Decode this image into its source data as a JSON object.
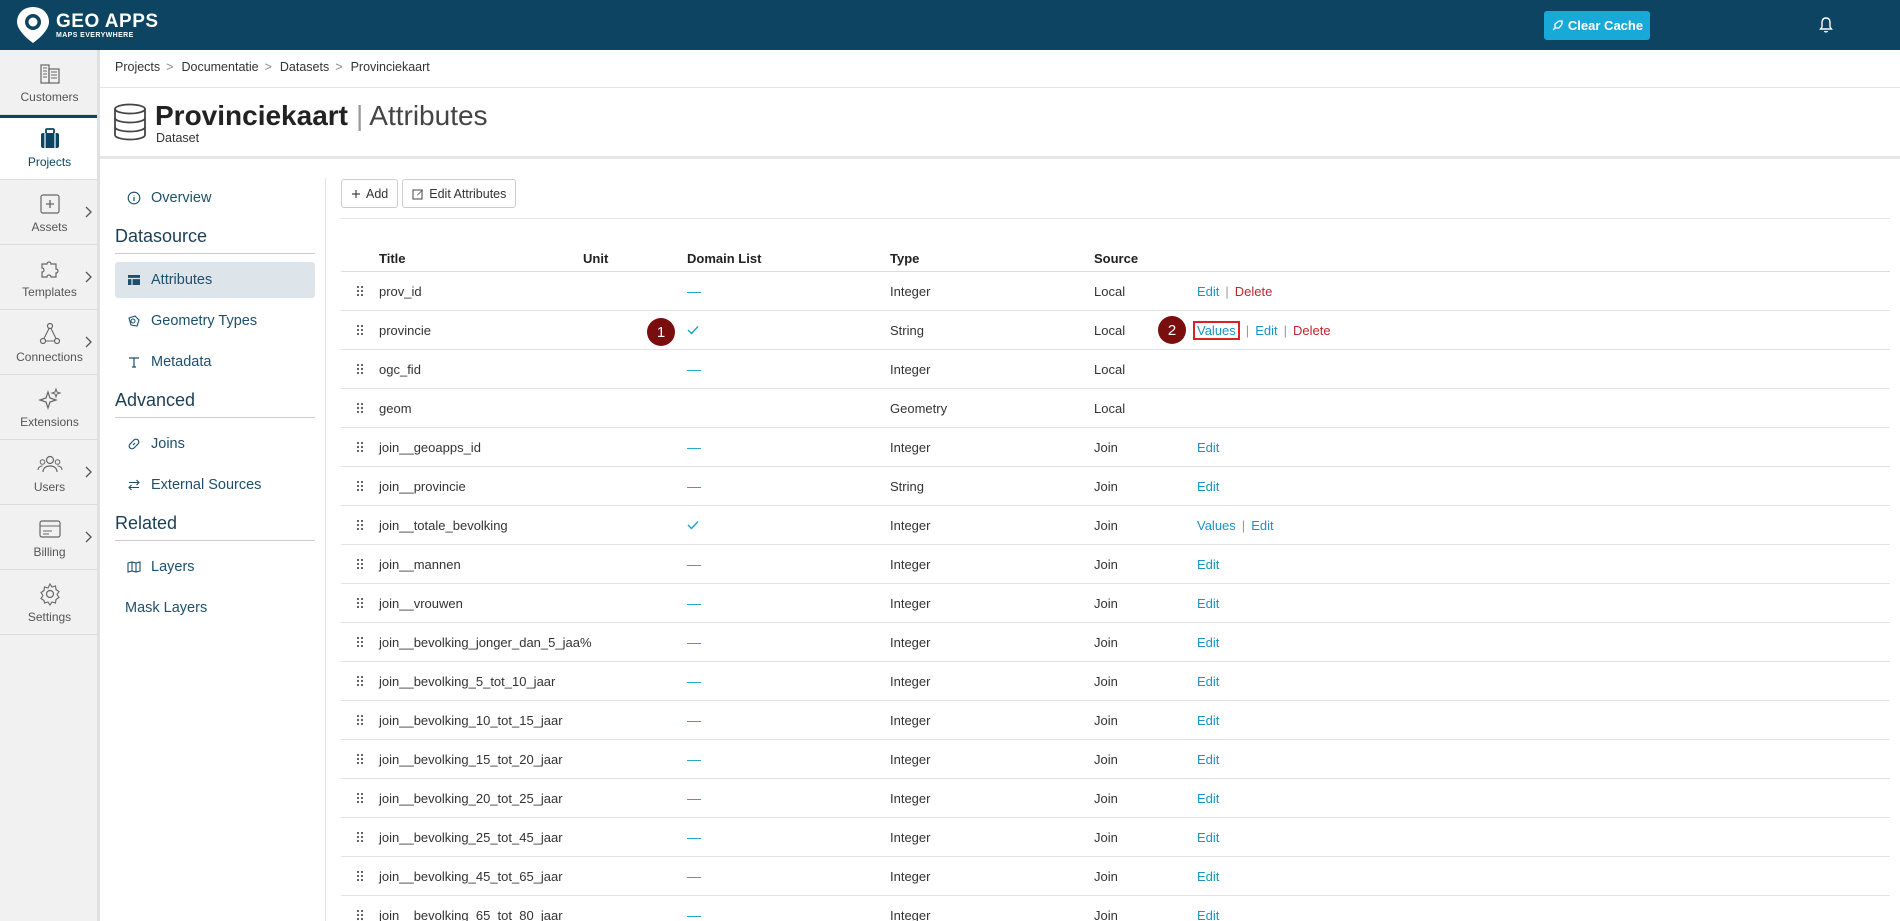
{
  "topbar": {
    "logo_title": "GEO APPS",
    "logo_subtitle": "MAPS EVERYWHERE",
    "clear_cache_label": "Clear Cache",
    "bg_color": "#0d4462",
    "accent_color": "#17a9d8"
  },
  "rail": {
    "items": [
      {
        "label": "Customers",
        "icon": "building-icon"
      },
      {
        "label": "Projects",
        "icon": "briefcase-icon"
      },
      {
        "label": "Assets",
        "icon": "plus-square-icon"
      },
      {
        "label": "Templates",
        "icon": "puzzle-icon"
      },
      {
        "label": "Connections",
        "icon": "share-nodes-icon"
      },
      {
        "label": "Extensions",
        "icon": "sparkles-icon"
      },
      {
        "label": "Users",
        "icon": "users-icon"
      },
      {
        "label": "Billing",
        "icon": "invoice-icon"
      },
      {
        "label": "Settings",
        "icon": "gear-icon"
      }
    ]
  },
  "breadcrumb": [
    "Projects",
    "Documentatie",
    "Datasets",
    "Provinciekaart"
  ],
  "header": {
    "title": "Provinciekaart",
    "subtitle": "Attributes",
    "kind": "Dataset"
  },
  "left_nav": {
    "overview": "Overview",
    "datasource_heading": "Datasource",
    "attributes": "Attributes",
    "geometry_types": "Geometry Types",
    "metadata": "Metadata",
    "advanced_heading": "Advanced",
    "joins": "Joins",
    "external_sources": "External Sources",
    "related_heading": "Related",
    "layers": "Layers",
    "mask_layers": "Mask Layers"
  },
  "toolbar": {
    "add_label": "Add",
    "edit_attributes_label": "Edit Attributes"
  },
  "table": {
    "columns": [
      "Title",
      "Unit",
      "Domain List",
      "Type",
      "Source"
    ],
    "action_labels": {
      "values": "Values",
      "edit": "Edit",
      "delete": "Delete",
      "separator": "|"
    },
    "rows": [
      {
        "title": "prov_id",
        "domain": "dash",
        "type": "Integer",
        "source": "Local",
        "actions": [
          "edit",
          "delete"
        ]
      },
      {
        "title": "provincie",
        "domain": "check",
        "type": "String",
        "source": "Local",
        "actions": [
          "values",
          "edit",
          "delete"
        ]
      },
      {
        "title": "ogc_fid",
        "domain": "dash",
        "type": "Integer",
        "source": "Local",
        "actions": []
      },
      {
        "title": "geom",
        "domain": "none",
        "type": "Geometry",
        "source": "Local",
        "actions": []
      },
      {
        "title": "join__geoapps_id",
        "domain": "dash",
        "type": "Integer",
        "source": "Join",
        "actions": [
          "edit"
        ]
      },
      {
        "title": "join__provincie",
        "domain": "dash",
        "type": "String",
        "source": "Join",
        "actions": [
          "edit"
        ]
      },
      {
        "title": "join__totale_bevolking",
        "domain": "check",
        "type": "Integer",
        "source": "Join",
        "actions": [
          "values",
          "edit"
        ]
      },
      {
        "title": "join__mannen",
        "domain": "dash",
        "type": "Integer",
        "source": "Join",
        "actions": [
          "edit"
        ]
      },
      {
        "title": "join__vrouwen",
        "domain": "dash",
        "type": "Integer",
        "source": "Join",
        "actions": [
          "edit"
        ]
      },
      {
        "title": "join__bevolking_jonger_dan_5_jaa%",
        "domain": "dash",
        "type": "Integer",
        "source": "Join",
        "actions": [
          "edit"
        ]
      },
      {
        "title": "join__bevolking_5_tot_10_jaar",
        "domain": "dash",
        "type": "Integer",
        "source": "Join",
        "actions": [
          "edit"
        ]
      },
      {
        "title": "join__bevolking_10_tot_15_jaar",
        "domain": "dash",
        "type": "Integer",
        "source": "Join",
        "actions": [
          "edit"
        ]
      },
      {
        "title": "join__bevolking_15_tot_20_jaar",
        "domain": "dash",
        "type": "Integer",
        "source": "Join",
        "actions": [
          "edit"
        ]
      },
      {
        "title": "join__bevolking_20_tot_25_jaar",
        "domain": "dash",
        "type": "Integer",
        "source": "Join",
        "actions": [
          "edit"
        ]
      },
      {
        "title": "join__bevolking_25_tot_45_jaar",
        "domain": "dash",
        "type": "Integer",
        "source": "Join",
        "actions": [
          "edit"
        ]
      },
      {
        "title": "join__bevolking_45_tot_65_jaar",
        "domain": "dash",
        "type": "Integer",
        "source": "Join",
        "actions": [
          "edit"
        ]
      },
      {
        "title": "join__bevolking_65_tot_80_jaar",
        "domain": "dash",
        "type": "Integer",
        "source": "Join",
        "actions": [
          "edit"
        ]
      }
    ]
  },
  "annotations": {
    "badge_1": "1",
    "badge_2": "2",
    "badge_color": "#7a0e0e",
    "highlight_color": "#e02020"
  }
}
